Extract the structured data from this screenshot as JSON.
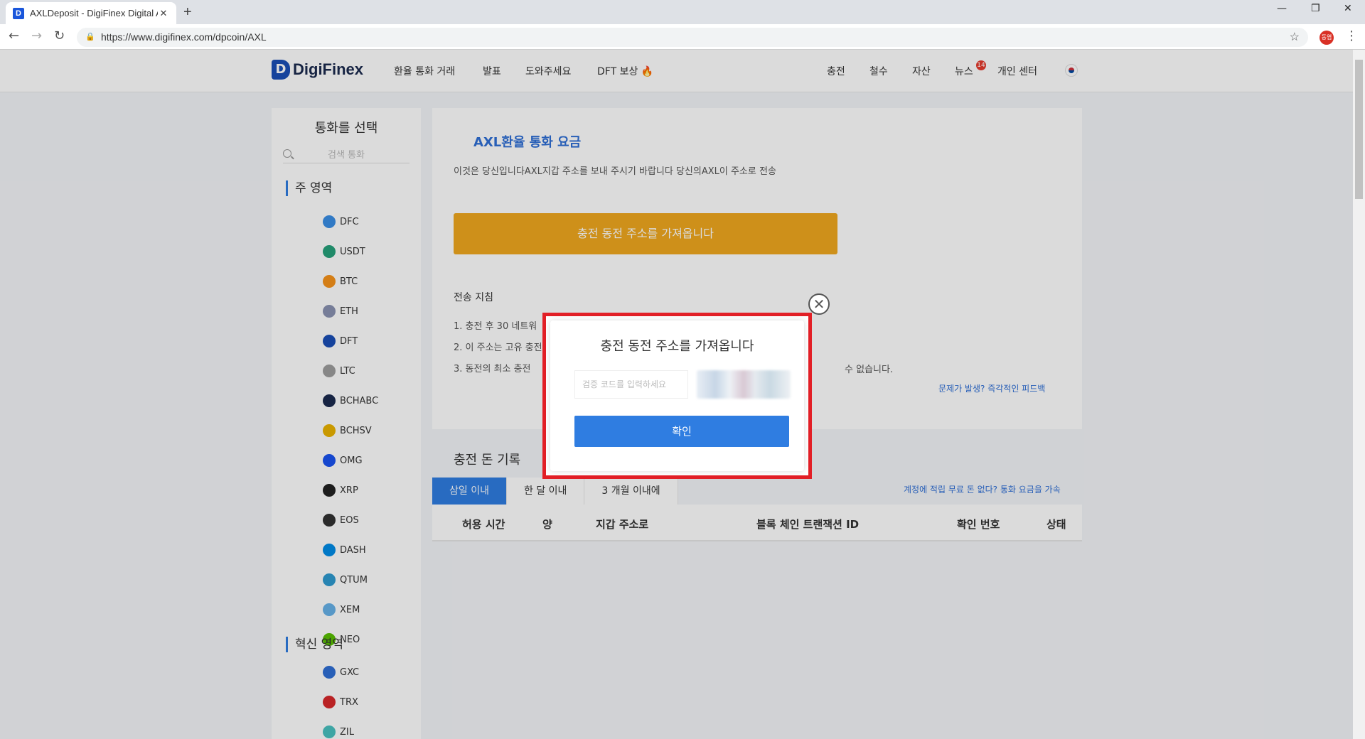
{
  "browser": {
    "tab_title": "AXLDeposit - DigiFinex Digital Asset",
    "new_tab": "+",
    "url": "https://www.digifinex.com/dpcoin/AXL",
    "profile_text": "동엽"
  },
  "header": {
    "logo_mark": "D",
    "logo_text": "DigiFinex",
    "nav": [
      "환율 통화 거래",
      "발표",
      "도와주세요",
      "DFT 보상"
    ],
    "right_nav": [
      "충전",
      "철수",
      "자산",
      "뉴스",
      "개인 센터"
    ],
    "news_badge": "14"
  },
  "sidebar": {
    "title": "통화를 선택",
    "search_placeholder": "검색 통화",
    "section_main": "주 영역",
    "section_innovation": "혁신 영역",
    "coins_main": [
      "DFC",
      "USDT",
      "BTC",
      "ETH",
      "DFT",
      "LTC",
      "BCHABC",
      "BCHSV",
      "OMG",
      "XRP",
      "EOS",
      "DASH",
      "QTUM",
      "XEM",
      "NEO"
    ],
    "coins_innovation": [
      "GXC",
      "TRX",
      "ZIL"
    ],
    "colors": {
      "DFC": "#3a8ee6",
      "USDT": "#26a17b",
      "BTC": "#f7931a",
      "ETH": "#8a92b2",
      "DFT": "#1a4fb6",
      "LTC": "#9e9e9e",
      "BCHABC": "#1b2a4e",
      "BCHSV": "#eab300",
      "OMG": "#1a53f0",
      "XRP": "#222222",
      "EOS": "#333333",
      "DASH": "#008ce7",
      "QTUM": "#2e9ad0",
      "XEM": "#67b2e8",
      "NEO": "#58bf00",
      "GXC": "#2f6fd6",
      "TRX": "#d8282a",
      "ZIL": "#49c1bf"
    }
  },
  "main": {
    "title": "AXL환율 통화 요금",
    "description": "이것은 당신입니다AXL지갑 주소를 보내 주시기 바랍니다 당신의AXL이 주소로 전송",
    "get_address_button": "충전 동전 주소를 가져옵니다",
    "instructions_title": "전송 지침",
    "instructions": [
      "1. 충전 후 30 네트워",
      "2. 이 주소는 고유 충전",
      "3. 동전의 최소 충전"
    ],
    "instruction_3_tail": "수 없습니다.",
    "feedback_link": "문제가 발생? 즉각적인 피드백",
    "records_title": "충전 돈 기록",
    "tabs": [
      "삼일 이내",
      "한 달 이내",
      "3 개월 이내에"
    ],
    "deposit_link": "계정에 적립 무료 돈 없다? 통화 요금을 가속",
    "table_headers": [
      "허용 시간",
      "양",
      "지갑 주소로",
      "블록 체인 트랜잭션 ID",
      "확인 번호",
      "상태"
    ]
  },
  "modal": {
    "title": "충전 동전 주소를 가져옵니다",
    "input_placeholder": "검증 코드를 입력하세요",
    "confirm_label": "확인",
    "close_symbol": "✕"
  },
  "accent_colors": {
    "primary": "#2f7de1",
    "orange": "#f0a81f",
    "highlight": "#e21f26"
  }
}
